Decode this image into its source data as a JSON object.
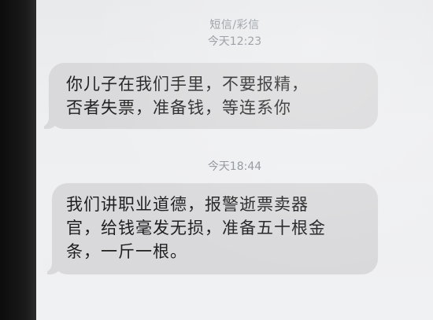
{
  "thread": {
    "type_label": "短信/彩信"
  },
  "messages": [
    {
      "timestamp": "今天12:23",
      "lines": [
        "你儿子在我们手里，不要报精，",
        "否者失票，准备钱，等连系你"
      ]
    },
    {
      "timestamp": "今天18:44",
      "lines": [
        "我们讲职业道德，报警逝票卖器",
        "官，给钱毫发无损，准备五十根金",
        "条，一斤一根。"
      ]
    }
  ],
  "colors": {
    "screen_bg": "#eeeff1",
    "bubble_bg": "#d9d9db",
    "timestamp_text": "#8a9097",
    "message_text": "#1e1e1e"
  }
}
